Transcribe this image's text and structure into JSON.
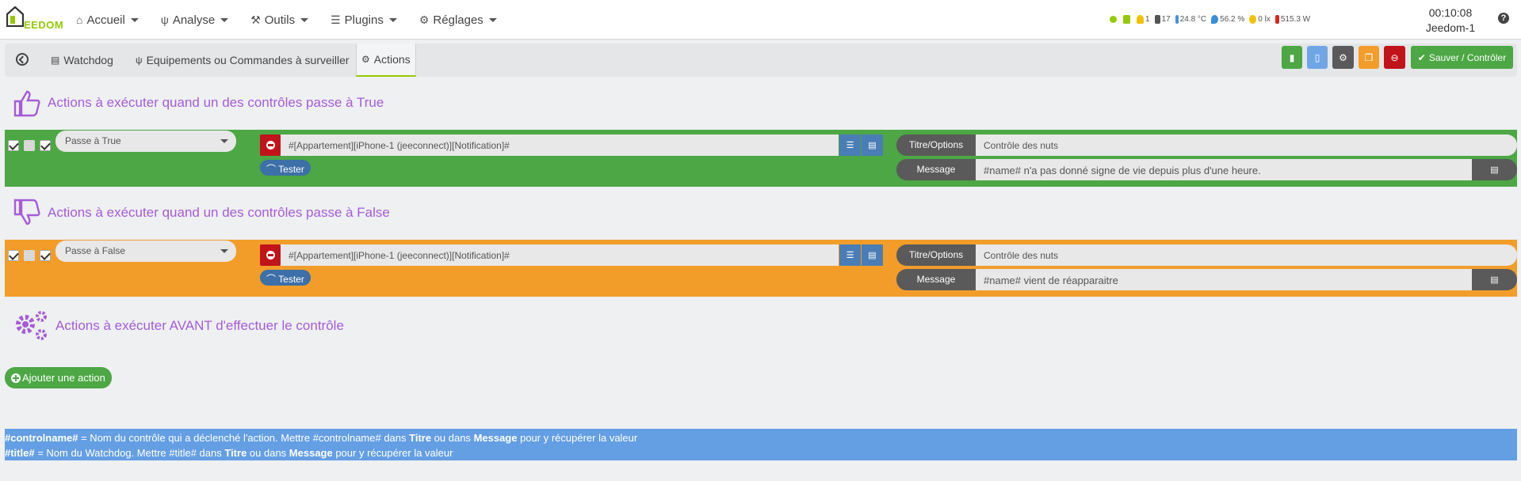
{
  "app": {
    "logo_text": "EEDOM"
  },
  "menu": [
    {
      "label": "Accueil",
      "icon": "home-icon"
    },
    {
      "label": "Analyse",
      "icon": "stethoscope-icon"
    },
    {
      "label": "Outils",
      "icon": "wrench-icon"
    },
    {
      "label": "Plugins",
      "icon": "list-icon"
    },
    {
      "label": "Réglages",
      "icon": "gear-icon"
    }
  ],
  "status": {
    "bulb_count": "1",
    "plug_count": "17",
    "temperature": "24.8 °C",
    "humidity": "56.2 %",
    "luminosity": "0 lx",
    "power": "515.3 W"
  },
  "clock": {
    "time": "00:10:08",
    "host": "Jeedom-1"
  },
  "tabs": [
    {
      "label": "Watchdog"
    },
    {
      "label": "Equipements ou Commandes à surveiller"
    },
    {
      "label": "Actions"
    }
  ],
  "toolbar": {
    "save_label": "Sauver / Contrôler"
  },
  "sections": {
    "true_heading": "Actions à exécuter quand un des contrôles passe à True",
    "false_heading": "Actions à exécuter quand un des contrôles passe à False",
    "before_heading": "Actions à exécuter AVANT d'effectuer le contrôle"
  },
  "rows": {
    "true": {
      "mode": "Passe à True",
      "command": "#[Appartement][iPhone-1 (jeeconnect)][Notification]#",
      "tester": "Tester",
      "title_label": "Titre/Options",
      "title_value": "Contrôle des nuts",
      "message_label": "Message",
      "message_value": "#name# n'a pas donné signe de vie depuis plus d'une heure."
    },
    "false": {
      "mode": "Passe à False",
      "command": "#[Appartement][iPhone-1 (jeeconnect)][Notification]#",
      "tester": "Tester",
      "title_label": "Titre/Options",
      "title_value": "Contrôle des nuts",
      "message_label": "Message",
      "message_value": "#name# vient de réapparaitre"
    }
  },
  "add_action_label": "Ajouter une action",
  "info": {
    "line1_key": "#controlname#",
    "line1_a": " = Nom du contrôle qui a déclenché l'action. Mettre #controlname# dans ",
    "line1_b": "Titre",
    "line1_c": " ou dans ",
    "line1_d": "Message",
    "line1_e": " pour y récupérer la valeur",
    "line2_key": "#title#",
    "line2_a": " = Nom du Watchdog. Mettre #title# dans ",
    "line2_b": "Titre",
    "line2_c": " ou dans ",
    "line2_d": "Message",
    "line2_e": " pour y récupérer la valeur"
  },
  "colors": {
    "true_row": "#4ca744",
    "false_row": "#f29d2a",
    "heading": "#a55cd8",
    "info_bar": "#649ee3"
  }
}
